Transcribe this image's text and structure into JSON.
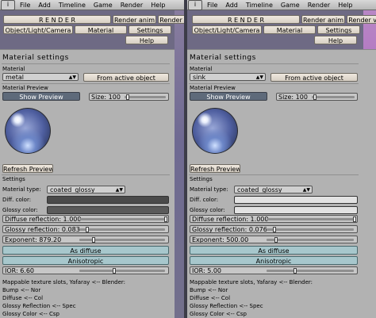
{
  "menubar": {
    "logo": "i",
    "items": [
      "File",
      "Add",
      "Timeline",
      "Game",
      "Render",
      "Help"
    ]
  },
  "top_buttons": {
    "render": "R E N D E R",
    "render_anim": "Render anim",
    "render_view": "Render view",
    "object_light_camera": "Object/Light/Camera",
    "material": "Material",
    "settings": "Settings",
    "help": "Help"
  },
  "left": {
    "title": "Material settings",
    "material_label": "Material",
    "material_value": "metal",
    "from_active": "From active object",
    "preview_label": "Material Preview",
    "show_preview": "Show Preview",
    "size_label": "Size: 100",
    "refresh_preview": "Refresh Preview",
    "settings_label": "Settings",
    "material_type_label": "Material type:",
    "material_type_value": "coated_glossy",
    "diff_color_label": "Diff. color:",
    "glossy_color_label": "Glossy color:",
    "diffuse_reflection": "Diffuse reflection: 1.000",
    "glossy_reflection": "Glossy reflection: 0.083",
    "exponent": "Exponent: 879.20",
    "as_diffuse": "As diffuse",
    "anisotropic": "Anisotropic",
    "ior": "IOR: 6.60",
    "mappable_title": "Mappable texture slots, Yafaray <-- Blender:",
    "mappable_lines": [
      "Bump <-- Nor",
      "Diffuse <-- Col",
      "Glossy Reflection <-- Spec",
      "Glossy Color <-- Csp"
    ],
    "colors": {
      "diff": "#4a4a4a",
      "glossy": "#5a5a5a"
    },
    "values": {
      "diffuse_reflection": 1.0,
      "glossy_reflection": 0.083,
      "exponent": 879.2,
      "size": 100,
      "ior": 6.6
    }
  },
  "right": {
    "title": "Material settings",
    "material_label": "Material",
    "material_value": "sink",
    "from_active": "From active object",
    "preview_label": "Material Preview",
    "show_preview": "Show Preview",
    "size_label": "Size: 100",
    "refresh_preview": "Refresh Preview",
    "settings_label": "Settings",
    "material_type_label": "Material type:",
    "material_type_value": "coated_glossy",
    "diff_color_label": "Diff. color:",
    "glossy_color_label": "Glossy color:",
    "diffuse_reflection": "Diffuse reflection: 1.000",
    "glossy_reflection": "Glossy reflection: 0.076",
    "exponent": "Exponent: 500.00",
    "as_diffuse": "As diffuse",
    "anisotropic": "Anisotropic",
    "ior": "IOR: 5.00",
    "mappable_title": "Mappable texture slots, Yafaray <-- Blender:",
    "mappable_lines": [
      "Bump <-- Nor",
      "Diffuse <-- Col",
      "Glossy Reflection <-- Spec",
      "Glossy Color <-- Csp"
    ],
    "colors": {
      "diff": "#e2e2e2",
      "glossy": "#e2e2e2"
    },
    "values": {
      "diffuse_reflection": 1.0,
      "glossy_reflection": 0.076,
      "exponent": 500.0,
      "size": 100,
      "ior": 5.0
    }
  }
}
